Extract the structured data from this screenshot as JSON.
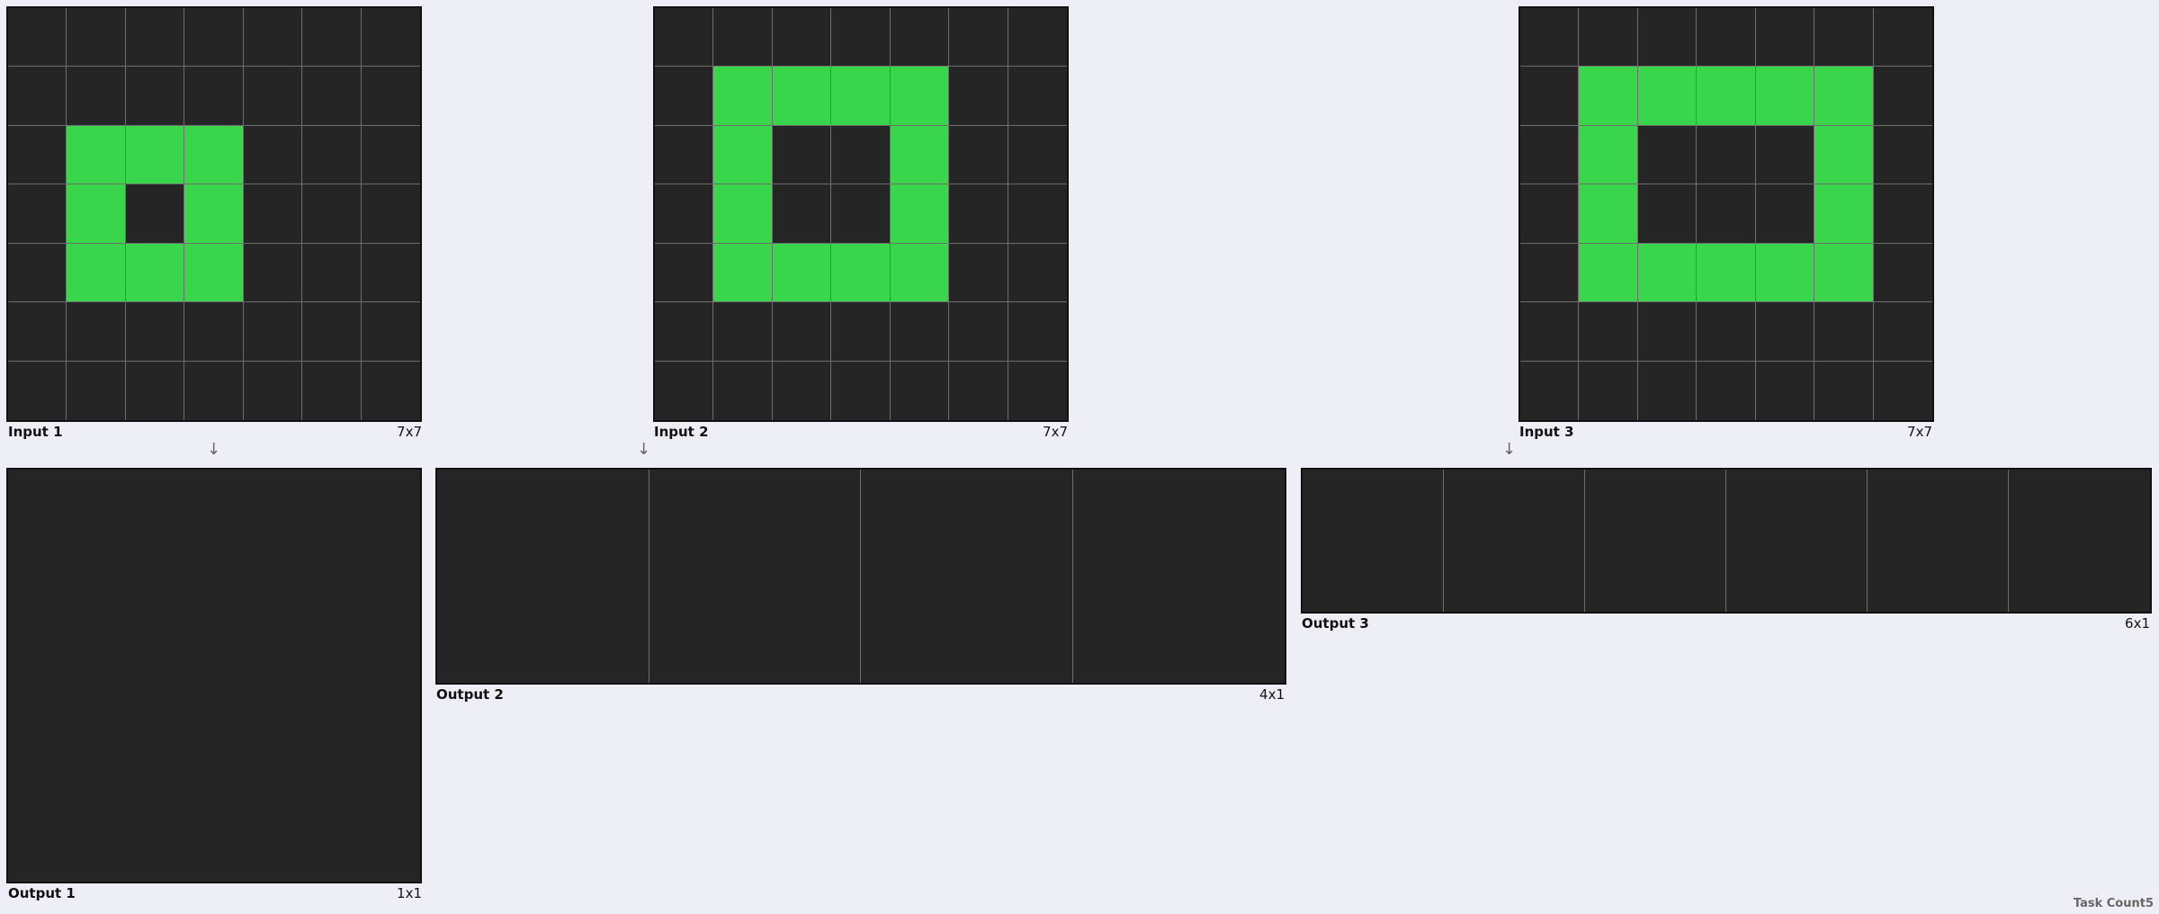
{
  "colors": {
    "background": "#252525",
    "fill": "#39d54a",
    "page": "#eeeff6"
  },
  "pairs": [
    {
      "input": {
        "label": "Input 1",
        "size": "7x7",
        "rows": [
          [
            0,
            0,
            0,
            0,
            0,
            0,
            0
          ],
          [
            0,
            0,
            0,
            0,
            0,
            0,
            0
          ],
          [
            0,
            1,
            1,
            1,
            0,
            0,
            0
          ],
          [
            0,
            1,
            0,
            1,
            0,
            0,
            0
          ],
          [
            0,
            1,
            1,
            1,
            0,
            0,
            0
          ],
          [
            0,
            0,
            0,
            0,
            0,
            0,
            0
          ],
          [
            0,
            0,
            0,
            0,
            0,
            0,
            0
          ]
        ]
      },
      "output": {
        "label": "Output 1",
        "size": "1x1",
        "rows": [
          [
            0
          ]
        ]
      }
    },
    {
      "input": {
        "label": "Input 2",
        "size": "7x7",
        "rows": [
          [
            0,
            0,
            0,
            0,
            0,
            0,
            0
          ],
          [
            0,
            1,
            1,
            1,
            1,
            0,
            0
          ],
          [
            0,
            1,
            0,
            0,
            1,
            0,
            0
          ],
          [
            0,
            1,
            0,
            0,
            1,
            0,
            0
          ],
          [
            0,
            1,
            1,
            1,
            1,
            0,
            0
          ],
          [
            0,
            0,
            0,
            0,
            0,
            0,
            0
          ],
          [
            0,
            0,
            0,
            0,
            0,
            0,
            0
          ]
        ]
      },
      "output": {
        "label": "Output 2",
        "size": "4x1",
        "rows": [
          [
            0,
            0,
            0,
            0
          ]
        ]
      }
    },
    {
      "input": {
        "label": "Input 3",
        "size": "7x7",
        "rows": [
          [
            0,
            0,
            0,
            0,
            0,
            0,
            0
          ],
          [
            0,
            1,
            1,
            1,
            1,
            1,
            0
          ],
          [
            0,
            1,
            0,
            0,
            0,
            1,
            0
          ],
          [
            0,
            1,
            0,
            0,
            0,
            1,
            0
          ],
          [
            0,
            1,
            1,
            1,
            1,
            1,
            0
          ],
          [
            0,
            0,
            0,
            0,
            0,
            0,
            0
          ],
          [
            0,
            0,
            0,
            0,
            0,
            0,
            0
          ]
        ]
      },
      "output": {
        "label": "Output 3",
        "size": "6x1",
        "rows": [
          [
            0,
            0,
            0,
            0,
            0,
            0
          ]
        ]
      }
    }
  ],
  "footer": "Task Count5"
}
